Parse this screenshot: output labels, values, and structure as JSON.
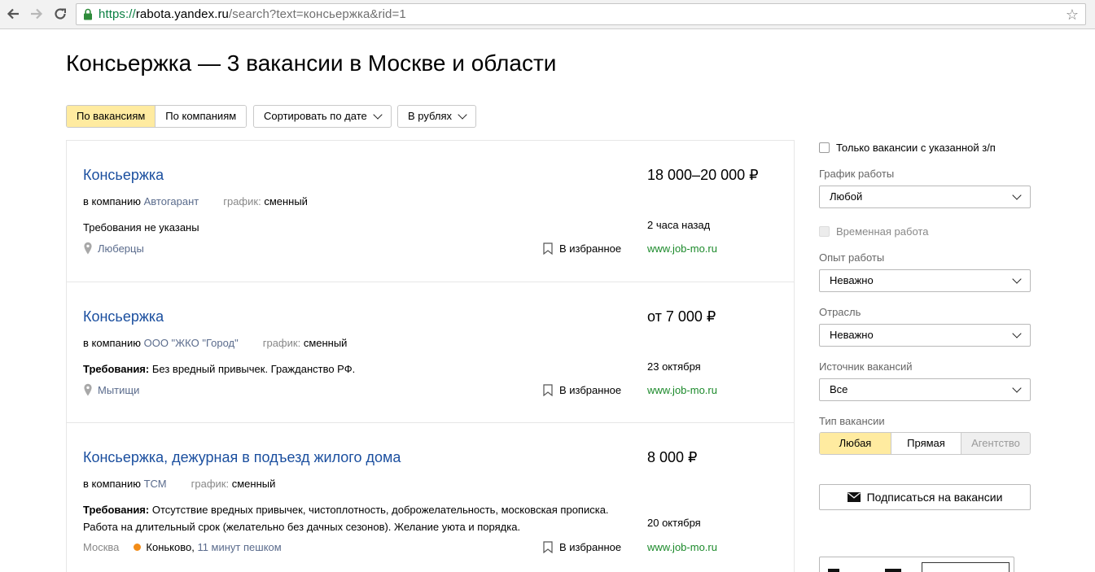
{
  "browser": {
    "url_protocol": "https://",
    "url_host": "rabota.yandex.ru",
    "url_path": "/search?text=консьержка&rid=1"
  },
  "page": {
    "title": "Консьержка — 3 вакансии в Москве и области"
  },
  "toolbar": {
    "tabs": [
      {
        "label": "По вакансиям",
        "active": true
      },
      {
        "label": "По компаниям",
        "active": false
      }
    ],
    "sort_label": "Сортировать по дате",
    "currency_label": "В рублях"
  },
  "common": {
    "company_prefix": "в компанию",
    "schedule_prefix": "график:",
    "favorite_label": "В избранное",
    "requirements_label": "Требования:"
  },
  "vacancies": [
    {
      "title": "Консьержка",
      "salary": "18 000–20 000 ₽",
      "company": "Автогарант",
      "schedule": "сменный",
      "requirements": "Требования не указаны",
      "date": "2 часа назад",
      "location": "Люберцы",
      "source": "www.job-mo.ru"
    },
    {
      "title": "Консьержка",
      "salary": "от 7 000 ₽",
      "company": "ООО \"ЖКО \"Город\"",
      "schedule": "сменный",
      "requirements": "Без вредный привычек. Гражданство РФ.",
      "date": "23 октября",
      "location": "Мытищи",
      "source": "www.job-mo.ru"
    },
    {
      "title": "Консьержка, дежурная в подъезд жилого дома",
      "salary": "8 000 ₽",
      "company": "ТСМ",
      "schedule": "сменный",
      "requirements": "Отсутствие вредных привычек, чистоплотность, доброжелательность, московская прописка. Работа на длительный срок (желательно без дачных сезонов). Желание уюта и порядка.",
      "date": "20 октября",
      "location": "Москва",
      "metro": "Коньково,",
      "walk": "11 минут пешком",
      "source": "www.job-mo.ru"
    }
  ],
  "filters": {
    "salary_only_label": "Только вакансии с указанной з/п",
    "schedule": {
      "label": "График работы",
      "value": "Любой"
    },
    "temporary_label": "Временная работа",
    "experience": {
      "label": "Опыт работы",
      "value": "Неважно"
    },
    "industry": {
      "label": "Отрасль",
      "value": "Неважно"
    },
    "source": {
      "label": "Источник вакансий",
      "value": "Все"
    },
    "type": {
      "label": "Тип вакансии",
      "options": [
        "Любая",
        "Прямая",
        "Агентство"
      ],
      "selected": "Любая"
    },
    "subscribe_label": "Подписаться на вакансии"
  },
  "colors": {
    "accent_yellow": "#ffeba0",
    "link_blue": "#1b4f9f",
    "source_green": "#1c8a2b",
    "metro_orange": "#f28c18"
  }
}
